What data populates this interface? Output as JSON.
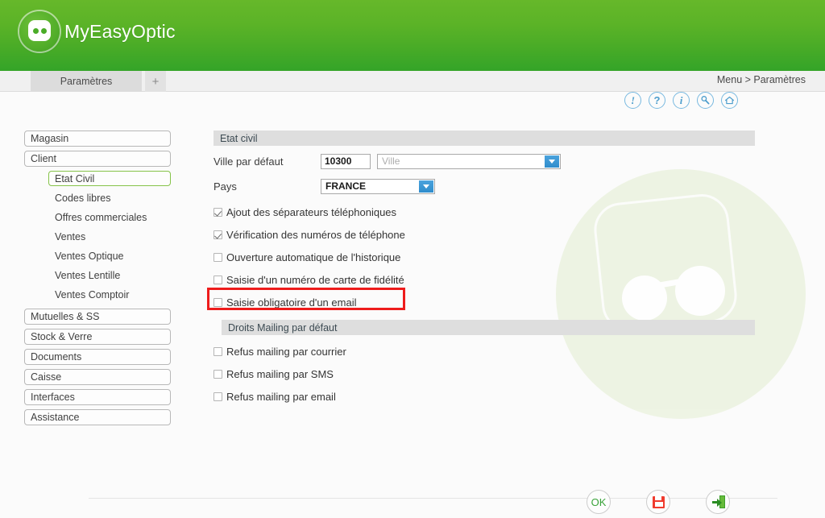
{
  "header": {
    "brand": "MyEasyOptic",
    "logo_icon": "glasses-logo-icon"
  },
  "tabs": {
    "items": [
      {
        "label": "Paramètres"
      }
    ],
    "add_label": "+"
  },
  "breadcrumb": "Menu > Paramètres",
  "toolbar": {
    "icons": [
      {
        "name": "alert-icon",
        "glyph": "!"
      },
      {
        "name": "help-icon",
        "glyph": "?"
      },
      {
        "name": "info-icon",
        "glyph": "i"
      },
      {
        "name": "tools-icon",
        "glyph": ""
      },
      {
        "name": "home-icon",
        "glyph": ""
      }
    ]
  },
  "sidebar": {
    "groups": [
      {
        "type": "top",
        "label": "Magasin",
        "active": false
      },
      {
        "type": "top",
        "label": "Client",
        "active": false
      },
      {
        "type": "sub",
        "label": "Etat Civil",
        "active": true
      },
      {
        "type": "sub",
        "label": "Codes libres",
        "active": false
      },
      {
        "type": "sub",
        "label": "Offres commerciales",
        "active": false
      },
      {
        "type": "sub",
        "label": "Ventes",
        "active": false
      },
      {
        "type": "sub",
        "label": "Ventes Optique",
        "active": false
      },
      {
        "type": "sub",
        "label": "Ventes Lentille",
        "active": false
      },
      {
        "type": "sub",
        "label": "Ventes Comptoir",
        "active": false
      },
      {
        "type": "top",
        "label": "Mutuelles & SS",
        "active": false
      },
      {
        "type": "top",
        "label": "Stock & Verre",
        "active": false
      },
      {
        "type": "top",
        "label": "Documents",
        "active": false
      },
      {
        "type": "top",
        "label": "Caisse",
        "active": false
      },
      {
        "type": "top",
        "label": "Interfaces",
        "active": false
      },
      {
        "type": "top",
        "label": "Assistance",
        "active": false
      }
    ]
  },
  "main": {
    "section_etat_civil": "Etat civil",
    "ville_label": "Ville par défaut",
    "ville_code_value": "10300",
    "ville_name_placeholder": "Ville",
    "ville_name_value": "",
    "pays_label": "Pays",
    "pays_value": "FRANCE",
    "checkboxes": [
      {
        "label": "Ajout des séparateurs téléphoniques",
        "checked": true
      },
      {
        "label": "Vérification des numéros de téléphone",
        "checked": true
      },
      {
        "label": "Ouverture automatique de l'historique",
        "checked": false
      },
      {
        "label": "Saisie d'un numéro de carte de fidélité",
        "checked": false
      },
      {
        "label": "Saisie obligatoire d'un email",
        "checked": false
      }
    ],
    "section_mailing": "Droits Mailing par défaut",
    "mailing_checkboxes": [
      {
        "label": "Refus mailing par courrier",
        "checked": false
      },
      {
        "label": "Refus mailing par SMS",
        "checked": false
      },
      {
        "label": "Refus mailing par email",
        "checked": false
      }
    ]
  },
  "footer": {
    "ok_label": "OK",
    "save_icon": "floppy-disk-icon",
    "exit_icon": "exit-door-icon"
  },
  "colors": {
    "brand_green_top": "#66b82a",
    "brand_green_bottom": "#34a428",
    "accent_blue": "#2f8dcc",
    "highlight_red": "#ee1c1c",
    "active_nav_border": "#86c34a",
    "section_bar": "#dedede"
  }
}
